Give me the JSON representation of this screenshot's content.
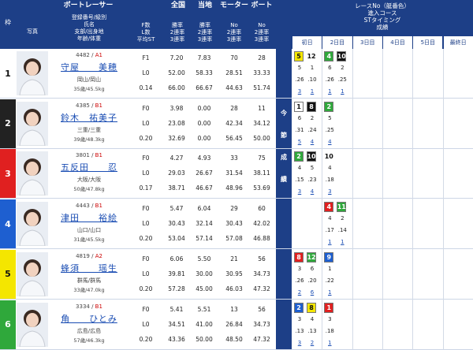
{
  "header": {
    "boat_racer": "ボートレーサー",
    "col_waku": "枠",
    "col_photo": "写真",
    "col_info": [
      "登録番号/級別",
      "氏名",
      "支部/出身地",
      "年齢/体重"
    ],
    "col_fl": [
      "F数",
      "L数",
      "平均ST"
    ],
    "col_zenkoku": "全国",
    "col_zenkoku_sub": [
      "勝率",
      "2連率",
      "3連率"
    ],
    "col_touchi": "当地",
    "col_touchi_sub": [
      "勝率",
      "2連率",
      "3連率"
    ],
    "col_motor": "モーター",
    "col_motor_sub": [
      "No",
      "2連率",
      "3連率"
    ],
    "col_boat": "ボート",
    "col_boat_sub": [
      "No",
      "2連率",
      "3連率"
    ],
    "right_title": [
      "レースNo（艇番色）",
      "進入コース",
      "STタイミング",
      "成績"
    ],
    "days": [
      "初日",
      "2日目",
      "3日目",
      "4日目",
      "5日目",
      "最終日"
    ],
    "side_text": [
      "今",
      "節",
      "成",
      "績"
    ]
  },
  "colors": {
    "navy": "#1d3f87",
    "lane1": "#ffffff",
    "lane2": "#111111",
    "lane3": "#e02020",
    "lane4": "#1e5fd0",
    "lane5": "#f4e600",
    "lane6": "#2fa83b"
  },
  "racers": [
    {
      "waku": "1",
      "regno": "4482",
      "rank": "A1",
      "name": "守屋　　美穂",
      "branch": "岡山/岡山",
      "age": "35歳/45.5kg",
      "f": "F1",
      "l": "L0",
      "st": "0.14",
      "zen": [
        "7.20",
        "52.00",
        "66.00"
      ],
      "tou": [
        "7.83",
        "58.33",
        "66.67"
      ],
      "motor": [
        "70",
        "28.51",
        "44.63"
      ],
      "boat": [
        "28",
        "33.33",
        "51.74"
      ],
      "results": [
        {
          "rno": [
            [
              "5",
              "lane5"
            ],
            [
              "12",
              "plain"
            ]
          ],
          "course": [
            "5",
            "1"
          ],
          "st": [
            ".26",
            ".10"
          ],
          "rank": [
            "3",
            "1"
          ]
        },
        {
          "rno": [
            [
              "4",
              "lane6"
            ],
            [
              "10",
              "lane2"
            ]
          ],
          "course": [
            "6",
            "2"
          ],
          "st": [
            ".26",
            ".25"
          ],
          "rank": [
            "1",
            "1"
          ]
        }
      ]
    },
    {
      "waku": "2",
      "regno": "4385",
      "rank": "B1",
      "name": "鈴木　祐美子",
      "branch": "三重/三重",
      "age": "39歳/48.3kg",
      "f": "F0",
      "l": "L0",
      "st": "0.20",
      "zen": [
        "3.98",
        "23.08",
        "32.69"
      ],
      "tou": [
        "0.00",
        "0.00",
        "0.00"
      ],
      "motor": [
        "28",
        "42.34",
        "56.45"
      ],
      "boat": [
        "11",
        "34.12",
        "50.00"
      ],
      "results": [
        {
          "rno": [
            [
              "1",
              "lane1"
            ],
            [
              "8",
              "lane2"
            ]
          ],
          "course": [
            "6",
            "2"
          ],
          "st": [
            ".31",
            ".24"
          ],
          "rank": [
            "5",
            "4"
          ]
        },
        {
          "rno": [
            [
              "2",
              "lane6"
            ]
          ],
          "course": [
            "5"
          ],
          "st": [
            ".25"
          ],
          "rank": [
            "4"
          ]
        }
      ]
    },
    {
      "waku": "3",
      "regno": "3801",
      "rank": "B1",
      "name": "五反田　　忍",
      "branch": "大阪/大阪",
      "age": "50歳/47.8kg",
      "f": "F0",
      "l": "L0",
      "st": "0.17",
      "zen": [
        "4.27",
        "29.03",
        "38.71"
      ],
      "tou": [
        "4.93",
        "26.67",
        "46.67"
      ],
      "motor": [
        "33",
        "31.54",
        "48.96"
      ],
      "boat": [
        "75",
        "38.11",
        "53.69"
      ],
      "results": [
        {
          "rno": [
            [
              "2",
              "lane6"
            ],
            [
              "10",
              "lane2"
            ]
          ],
          "course": [
            "4",
            "5"
          ],
          "st": [
            ".15",
            ".23"
          ],
          "rank": [
            "3",
            "4"
          ]
        },
        {
          "rno": [
            [
              "10",
              "plain"
            ]
          ],
          "course": [
            "4"
          ],
          "st": [
            ".18"
          ],
          "rank": [
            "3"
          ]
        }
      ]
    },
    {
      "waku": "4",
      "regno": "4443",
      "rank": "B1",
      "name": "津田　　裕絵",
      "branch": "山口/山口",
      "age": "31歳/45.5kg",
      "f": "F0",
      "l": "L0",
      "st": "0.20",
      "zen": [
        "5.47",
        "30.43",
        "53.04"
      ],
      "tou": [
        "6.04",
        "32.14",
        "57.14"
      ],
      "motor": [
        "29",
        "30.43",
        "57.08"
      ],
      "boat": [
        "60",
        "42.02",
        "46.88"
      ],
      "results": [
        {
          "rno": [],
          "course": [
            "",
            ""
          ],
          "st": [
            "",
            ""
          ],
          "rank": [
            "",
            ""
          ]
        },
        {
          "rno": [
            [
              "4",
              "lane3"
            ],
            [
              "11",
              "lane6"
            ]
          ],
          "course": [
            "4",
            "2"
          ],
          "st": [
            ".17",
            ".14"
          ],
          "rank": [
            "1",
            "1"
          ]
        }
      ]
    },
    {
      "waku": "5",
      "regno": "4819",
      "rank": "A2",
      "name": "蜂須　　瑶生",
      "branch": "群馬/群馬",
      "age": "33歳/47.0kg",
      "f": "F0",
      "l": "L0",
      "st": "0.20",
      "zen": [
        "6.06",
        "39.81",
        "57.28"
      ],
      "tou": [
        "5.50",
        "30.00",
        "45.00"
      ],
      "motor": [
        "21",
        "30.95",
        "46.03"
      ],
      "boat": [
        "56",
        "34.73",
        "47.32"
      ],
      "results": [
        {
          "rno": [
            [
              "8",
              "lane3"
            ],
            [
              "12",
              "lane6"
            ]
          ],
          "course": [
            "3",
            "6"
          ],
          "st": [
            ".26",
            ".20"
          ],
          "rank": [
            "2",
            "6"
          ]
        },
        {
          "rno": [
            [
              "9",
              "lane4"
            ]
          ],
          "course": [
            "1"
          ],
          "st": [
            ".22"
          ],
          "rank": [
            "1"
          ]
        }
      ]
    },
    {
      "waku": "6",
      "regno": "3334",
      "rank": "B1",
      "name": "角　　ひとみ",
      "branch": "広島/広島",
      "age": "57歳/46.3kg",
      "f": "F0",
      "l": "L0",
      "st": "0.20",
      "zen": [
        "5.41",
        "34.51",
        "43.36"
      ],
      "tou": [
        "5.51",
        "41.00",
        "50.00"
      ],
      "motor": [
        "13",
        "26.84",
        "48.50"
      ],
      "boat": [
        "56",
        "34.73",
        "47.32"
      ],
      "results": [
        {
          "rno": [
            [
              "2",
              "lane4"
            ],
            [
              "8",
              "lane5"
            ]
          ],
          "course": [
            "3",
            "4"
          ],
          "st": [
            ".13",
            ".13"
          ],
          "rank": [
            "3",
            "2"
          ]
        },
        {
          "rno": [
            [
              "1",
              "lane3"
            ]
          ],
          "course": [
            "3"
          ],
          "st": [
            ".18"
          ],
          "rank": [
            "1"
          ]
        }
      ]
    }
  ]
}
